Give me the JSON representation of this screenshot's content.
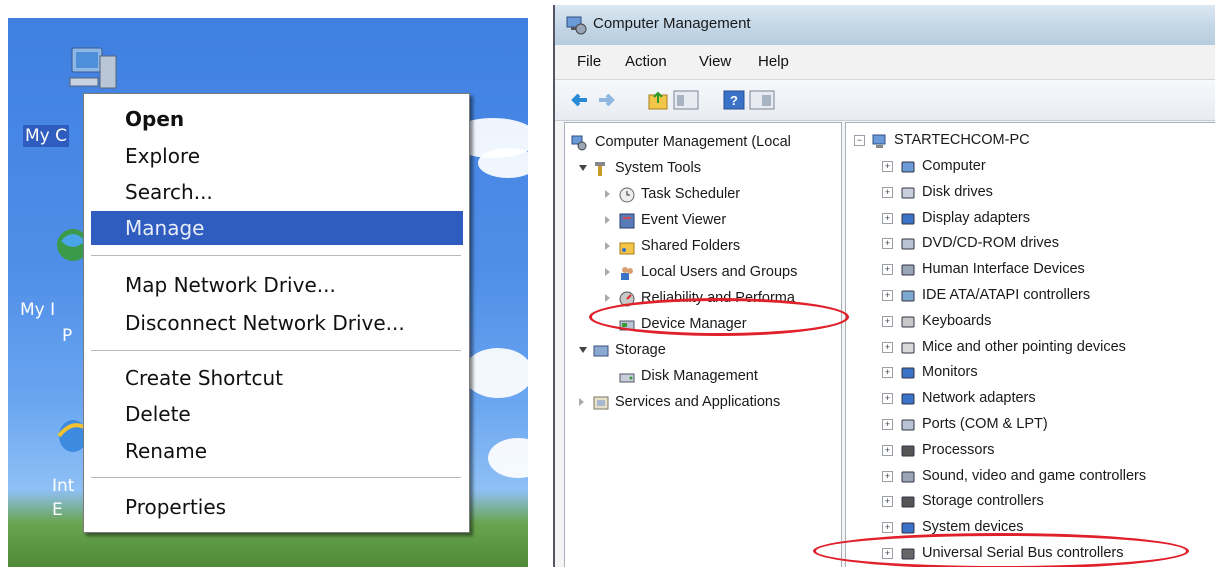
{
  "desktop": {
    "icon_labels": [
      "My C",
      "My I",
      "P",
      "Int",
      "E"
    ]
  },
  "context_menu": {
    "items": [
      {
        "label": "Open",
        "bold": true
      },
      {
        "label": "Explore"
      },
      {
        "label": "Search..."
      },
      {
        "label": "Manage",
        "selected": true
      },
      {
        "label": "Map Network Drive..."
      },
      {
        "label": "Disconnect Network Drive..."
      },
      {
        "label": "Create Shortcut"
      },
      {
        "label": "Delete"
      },
      {
        "label": "Rename"
      },
      {
        "label": "Properties"
      }
    ]
  },
  "window": {
    "title": "Computer Management",
    "menu": [
      "File",
      "Action",
      "View",
      "Help"
    ],
    "left_tree": [
      {
        "label": "Computer Management (Local",
        "icon": "computer-management-icon"
      },
      {
        "label": "System Tools",
        "icon": "system-tools-icon"
      },
      {
        "label": "Task Scheduler",
        "icon": "clock-icon"
      },
      {
        "label": "Event Viewer",
        "icon": "event-viewer-icon"
      },
      {
        "label": "Shared Folders",
        "icon": "shared-folders-icon"
      },
      {
        "label": "Local Users and Groups",
        "icon": "users-icon"
      },
      {
        "label": "Reliability and Performa",
        "icon": "performance-icon"
      },
      {
        "label": "Device Manager",
        "icon": "device-manager-icon",
        "highlighted": true
      },
      {
        "label": "Storage",
        "icon": "storage-icon"
      },
      {
        "label": "Disk Management",
        "icon": "disk-management-icon"
      },
      {
        "label": "Services and Applications",
        "icon": "services-icon"
      }
    ],
    "device_tree": {
      "root": "STARTECHCOM-PC",
      "items": [
        {
          "label": "Computer",
          "icon": "computer-icon"
        },
        {
          "label": "Disk drives",
          "icon": "disk-drive-icon"
        },
        {
          "label": "Display adapters",
          "icon": "display-adapter-icon"
        },
        {
          "label": "DVD/CD-ROM drives",
          "icon": "dvd-icon"
        },
        {
          "label": "Human Interface Devices",
          "icon": "hid-icon"
        },
        {
          "label": "IDE ATA/ATAPI controllers",
          "icon": "ide-icon"
        },
        {
          "label": "Keyboards",
          "icon": "keyboard-icon"
        },
        {
          "label": "Mice and other pointing devices",
          "icon": "mouse-icon"
        },
        {
          "label": "Monitors",
          "icon": "monitor-icon"
        },
        {
          "label": "Network adapters",
          "icon": "network-adapter-icon"
        },
        {
          "label": "Ports (COM & LPT)",
          "icon": "port-icon"
        },
        {
          "label": "Processors",
          "icon": "processor-icon"
        },
        {
          "label": "Sound, video and game controllers",
          "icon": "sound-icon"
        },
        {
          "label": "Storage controllers",
          "icon": "storage-controller-icon"
        },
        {
          "label": "System devices",
          "icon": "system-devices-icon"
        },
        {
          "label": "Universal Serial Bus controllers",
          "icon": "usb-icon",
          "highlighted": true
        }
      ]
    }
  },
  "colors": {
    "highlight_ellipse": "#e0202a",
    "menu_selection": "#2f5cbf"
  }
}
